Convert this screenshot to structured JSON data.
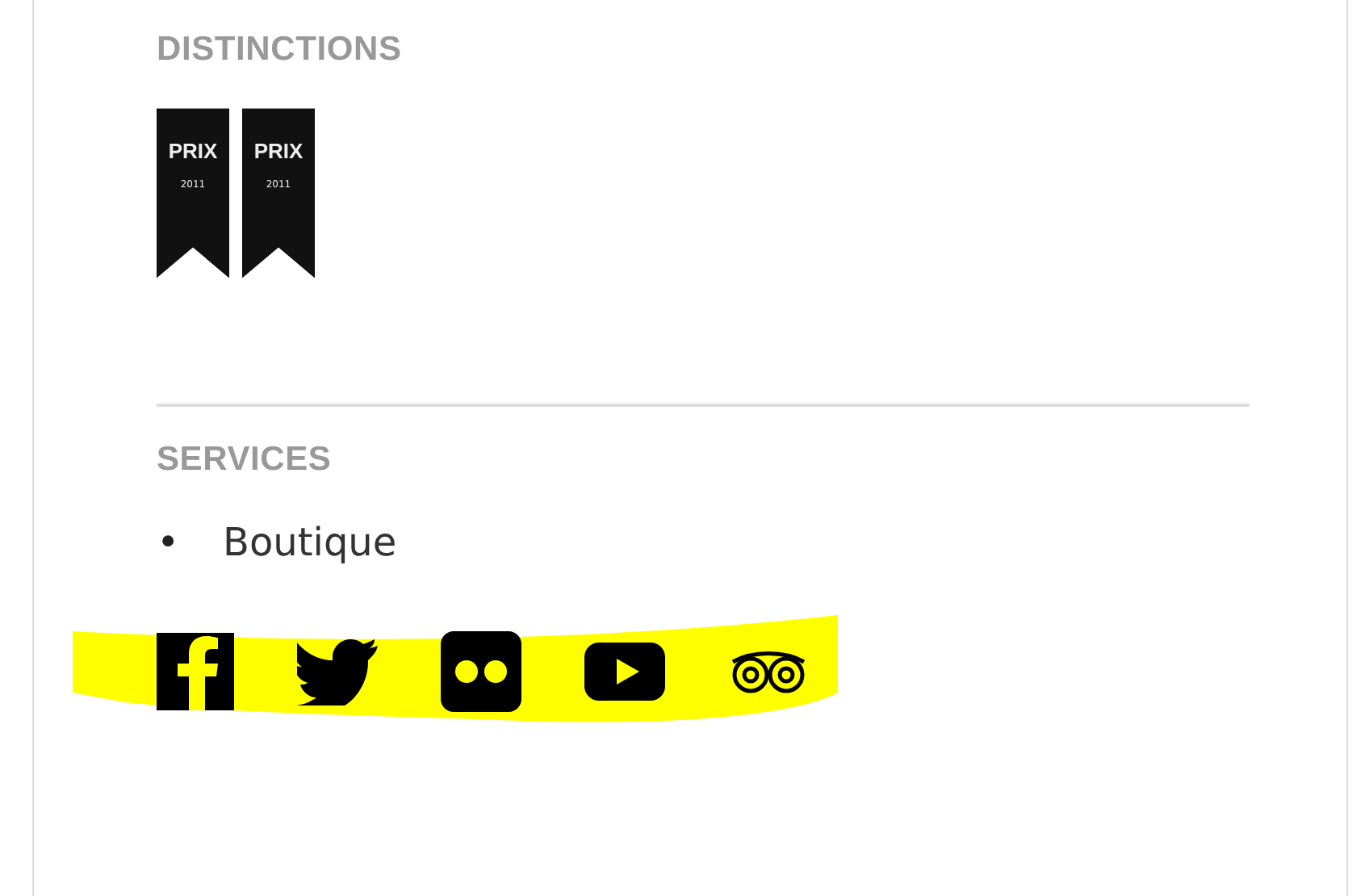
{
  "distinctions": {
    "title": "DISTINCTIONS",
    "badges": [
      {
        "label": "PRIX",
        "year": "2011"
      },
      {
        "label": "PRIX",
        "year": "2011"
      }
    ]
  },
  "services": {
    "title": "SERVICES",
    "items": [
      {
        "bullet": "•",
        "label": "Boutique"
      }
    ]
  },
  "social_links": [
    {
      "kind": "f"
    },
    {
      "kind": "bird"
    },
    {
      "kind": "dots"
    },
    {
      "kind": "play"
    },
    {
      "kind": "owl"
    }
  ]
}
